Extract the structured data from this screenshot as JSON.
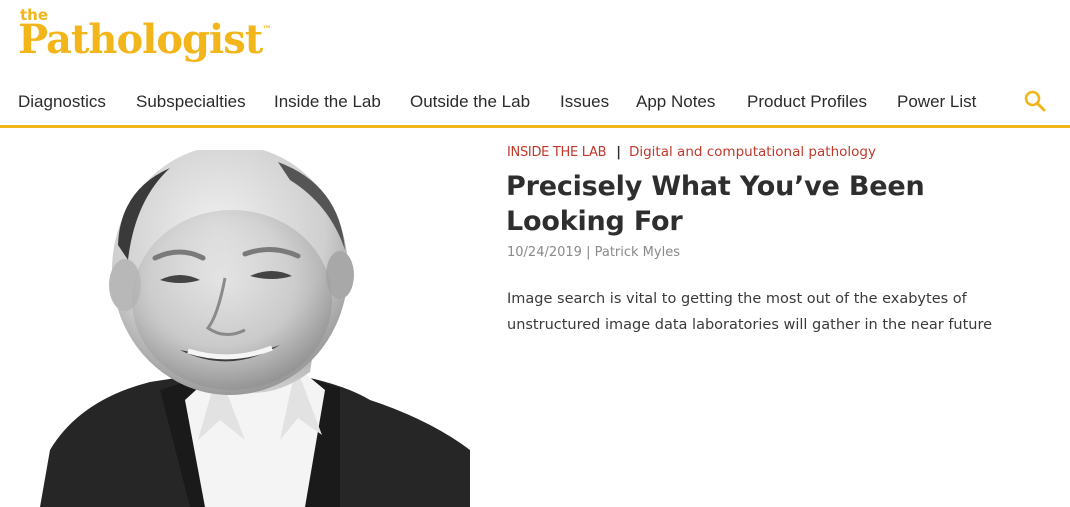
{
  "brand": {
    "small": "the",
    "main": "Pathologist",
    "tm": "™",
    "color": "#f2b61b"
  },
  "nav": {
    "items": [
      {
        "label": "Diagnostics"
      },
      {
        "label": "Subspecialties"
      },
      {
        "label": "Inside the Lab"
      },
      {
        "label": "Outside the Lab"
      },
      {
        "label": "Issues"
      },
      {
        "label": "App Notes"
      },
      {
        "label": "Product Profiles"
      },
      {
        "label": "Power List"
      }
    ],
    "search_icon": "search-icon"
  },
  "article": {
    "category": "INSIDE THE LAB",
    "separator": "|",
    "subcategory": "Digital and computational pathology",
    "title": "Precisely What You’ve Been Looking For",
    "date": "10/24/2019",
    "byline_sep": " | ",
    "author": "Patrick Myles",
    "summary": "Image search is vital to getting the most out of the exabytes of unstructured image data laboratories will gather in the near future",
    "image": "portrait-photo"
  },
  "colors": {
    "accent": "#f2b61b",
    "category": "#c0392b",
    "muted": "#8a8a8a"
  }
}
